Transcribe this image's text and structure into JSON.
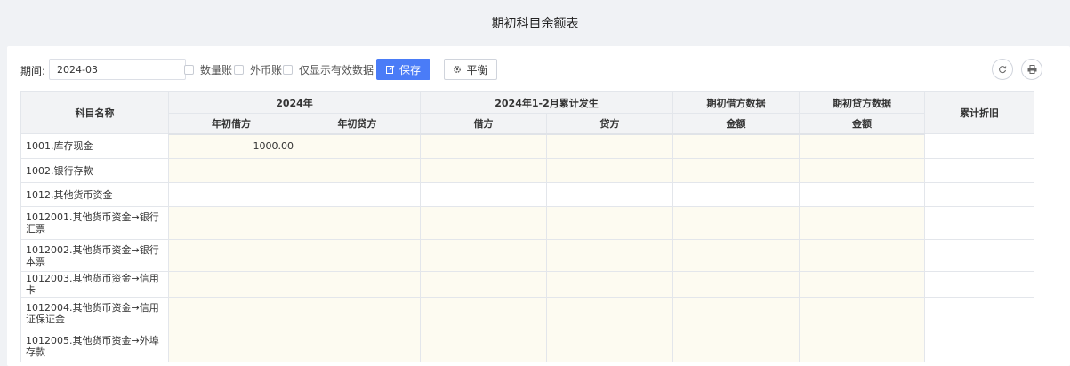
{
  "page": {
    "title": "期初科目余额表"
  },
  "toolbar": {
    "period_label": "期间:",
    "period_value": "2024-03",
    "checkboxes": [
      {
        "label": "数量账",
        "checked": false
      },
      {
        "label": "外币账",
        "checked": false
      },
      {
        "label": "仅显示有效数据",
        "checked": false
      }
    ],
    "save_label": "保存",
    "balance_label": "平衡",
    "accent_color": "#4a7cf7"
  },
  "table": {
    "headers": {
      "name": "科目名称",
      "group_2024": "2024年",
      "year_debit": "年初借方",
      "year_credit": "年初贷方",
      "group_accum": "2024年1-2月累计发生",
      "debit": "借方",
      "credit": "贷方",
      "opening_debit_group": "期初借方数据",
      "opening_debit_amount": "金额",
      "opening_credit_group": "期初贷方数据",
      "opening_credit_amount": "金额",
      "accum_depreciation": "累计折旧"
    },
    "rows": [
      {
        "name": "1001.库存现金",
        "year_debit": "1000.00"
      },
      {
        "name": "1002.银行存款",
        "year_debit": ""
      },
      {
        "name": "1012.其他货币资金",
        "year_debit": ""
      },
      {
        "name": "1012001.其他货币资金→银行汇票",
        "year_debit": ""
      },
      {
        "name": "1012002.其他货币资金→银行本票",
        "year_debit": ""
      },
      {
        "name": "1012003.其他货币资金→信用卡",
        "year_debit": ""
      },
      {
        "name": "1012004.其他货币资金→信用证保证金",
        "year_debit": ""
      },
      {
        "name": "1012005.其他货币资金→外埠存款",
        "year_debit": ""
      }
    ]
  }
}
